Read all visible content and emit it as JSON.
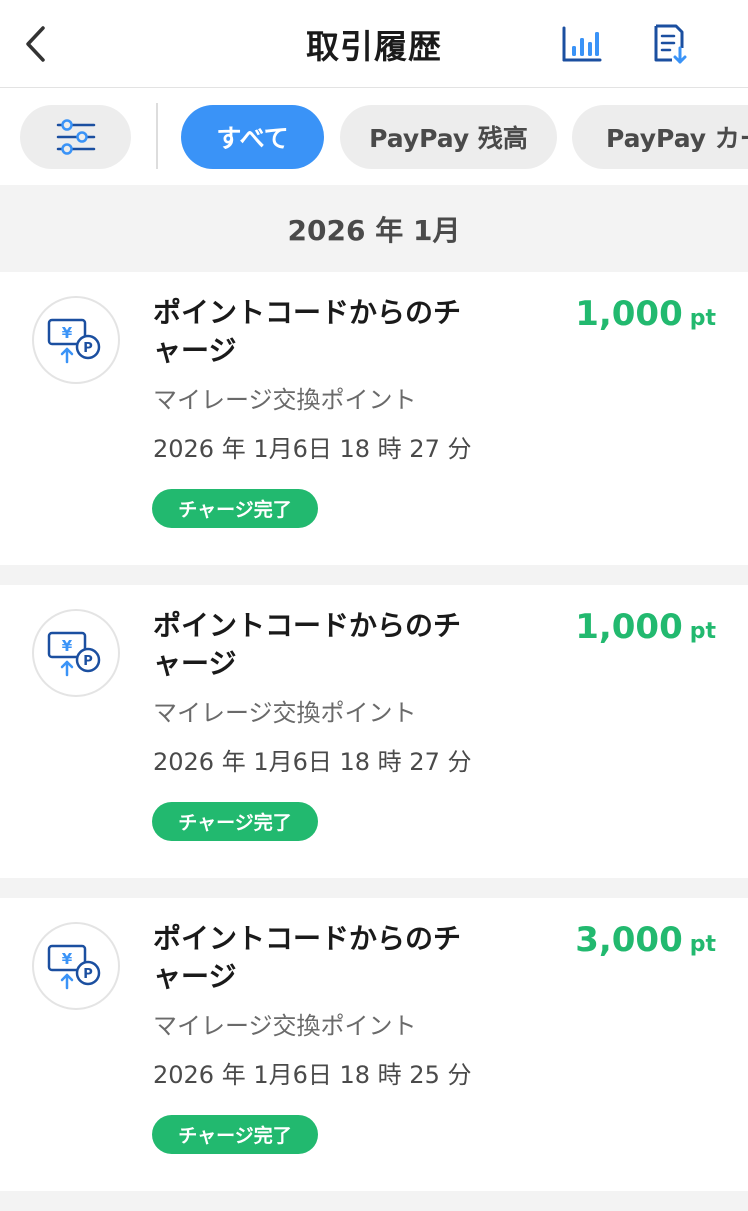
{
  "header": {
    "title": "取引履歴",
    "back_icon": "chevron-left-icon",
    "chart_icon": "bar-chart-icon",
    "export_icon": "document-download-icon"
  },
  "filters": {
    "settings_icon": "sliders-icon",
    "chips": [
      {
        "label": "すべて",
        "selected": true
      },
      {
        "label": "PayPay 残高",
        "selected": false
      },
      {
        "label": "PayPay カー",
        "selected": false
      }
    ]
  },
  "month": "2026 年 1月",
  "transactions": [
    {
      "icon": "point-charge-icon",
      "title": "ポイントコードからのチャージ",
      "subtitle": "マイレージ交換ポイント",
      "datetime": "2026 年 1月6日 18 時 27 分",
      "status": "チャージ完了",
      "amount": "1,000",
      "unit": "pt"
    },
    {
      "icon": "point-charge-icon",
      "title": "ポイントコードからのチャージ",
      "subtitle": "マイレージ交換ポイント",
      "datetime": "2026 年 1月6日 18 時 27 分",
      "status": "チャージ完了",
      "amount": "1,000",
      "unit": "pt"
    },
    {
      "icon": "point-charge-icon",
      "title": "ポイントコードからのチャージ",
      "subtitle": "マイレージ交換ポイント",
      "datetime": "2026 年 1月6日 18 時 25 分",
      "status": "チャージ完了",
      "amount": "3,000",
      "unit": "pt"
    }
  ],
  "colors": {
    "accent": "#3a93f7",
    "positive": "#22b96f",
    "icon_blue": "#1b4fa0"
  }
}
